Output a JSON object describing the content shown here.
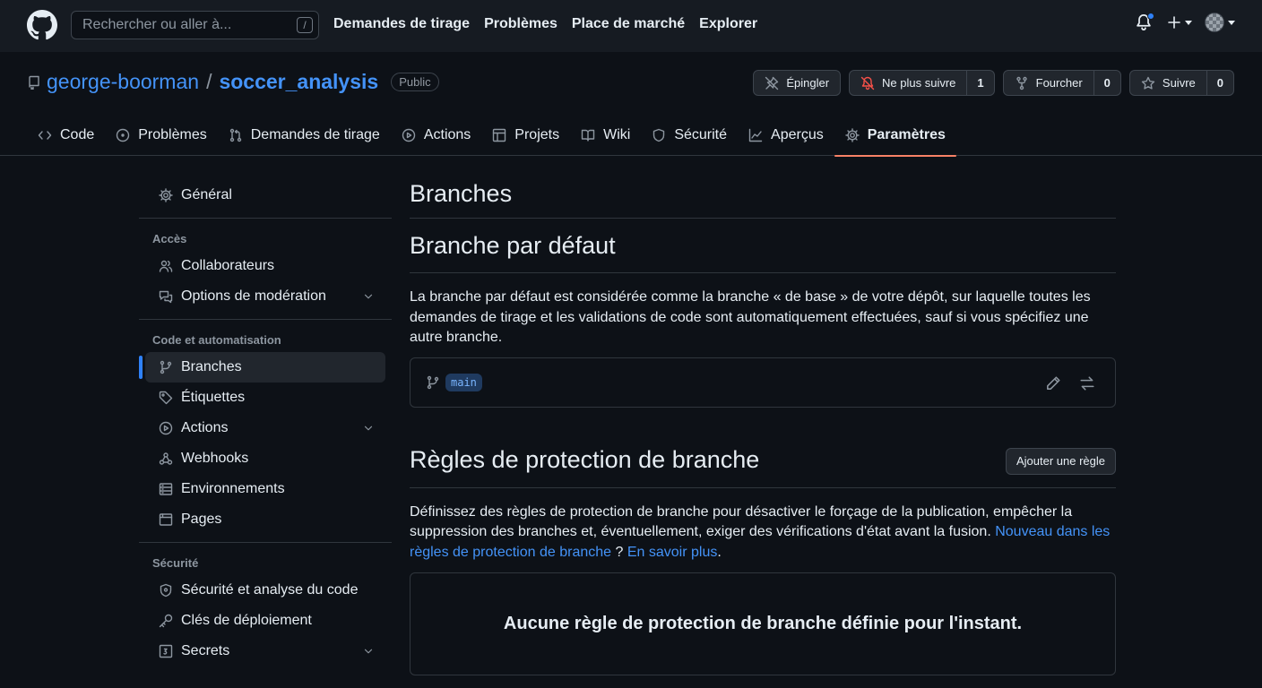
{
  "header": {
    "search_placeholder": "Rechercher ou aller à...",
    "search_shortcut": "/",
    "nav": [
      "Demandes de tirage",
      "Problèmes",
      "Place de marché",
      "Explorer"
    ]
  },
  "repo": {
    "owner": "george-boorman",
    "separator": "/",
    "name": "soccer_analysis",
    "visibility": "Public",
    "actions": {
      "pin": "Épingler",
      "unwatch": "Ne plus suivre",
      "unwatch_count": "1",
      "fork": "Fourcher",
      "fork_count": "0",
      "star": "Suivre",
      "star_count": "0"
    },
    "tabs": [
      "Code",
      "Problèmes",
      "Demandes de tirage",
      "Actions",
      "Projets",
      "Wiki",
      "Sécurité",
      "Aperçus",
      "Paramètres"
    ]
  },
  "sidebar": {
    "general": "Général",
    "access_heading": "Accès",
    "collaborators": "Collaborateurs",
    "moderation": "Options de modération",
    "code_heading": "Code et automatisation",
    "branches": "Branches",
    "tags": "Étiquettes",
    "actions": "Actions",
    "webhooks": "Webhooks",
    "environments": "Environnements",
    "pages": "Pages",
    "security_heading": "Sécurité",
    "code_security": "Sécurité et analyse du code",
    "deploy_keys": "Clés de déploiement",
    "secrets": "Secrets"
  },
  "main": {
    "title": "Branches",
    "default_title": "Branche par défaut",
    "default_desc": "La branche par défaut est considérée comme la branche « de base » de votre dépôt, sur laquelle toutes les demandes de tirage et les validations de code sont automatiquement effectuées, sauf si vous spécifiez une autre branche.",
    "default_branch": "main",
    "rules_title": "Règles de protection de branche",
    "add_rule": "Ajouter une règle",
    "rules_desc": "Définissez des règles de protection de branche pour désactiver le forçage de la publication, empêcher la suppression des branches et, éventuellement, exiger des vérifications d'état avant la fusion.",
    "rules_link1": "Nouveau dans les règles de protection de branche",
    "rules_q": " ? ",
    "rules_link2": "En savoir plus",
    "rules_end": ".",
    "empty": "Aucune règle de protection de branche définie pour l'instant."
  }
}
